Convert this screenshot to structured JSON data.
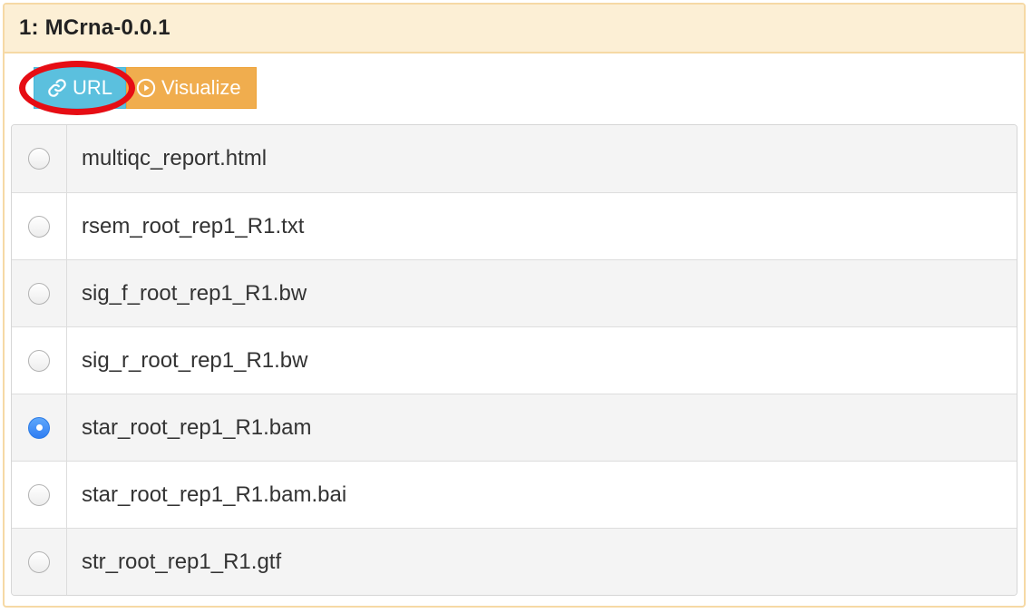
{
  "panel": {
    "title": "1: MCrna-0.0.1"
  },
  "buttons": {
    "url_label": "URL",
    "visualize_label": "Visualize"
  },
  "files": [
    {
      "name": "multiqc_report.html",
      "selected": false
    },
    {
      "name": "rsem_root_rep1_R1.txt",
      "selected": false
    },
    {
      "name": "sig_f_root_rep1_R1.bw",
      "selected": false
    },
    {
      "name": "sig_r_root_rep1_R1.bw",
      "selected": false
    },
    {
      "name": "star_root_rep1_R1.bam",
      "selected": true
    },
    {
      "name": "star_root_rep1_R1.bam.bai",
      "selected": false
    },
    {
      "name": "str_root_rep1_R1.gtf",
      "selected": false
    }
  ],
  "colors": {
    "url_button": "#5bc0de",
    "visualize_button": "#f0ad4e",
    "heading_bg": "#fcefd5",
    "highlight_ring": "#e60d14",
    "radio_selected": "#2f7ef3"
  },
  "icons": {
    "url": "link-icon",
    "visualize": "play-circle-icon"
  }
}
